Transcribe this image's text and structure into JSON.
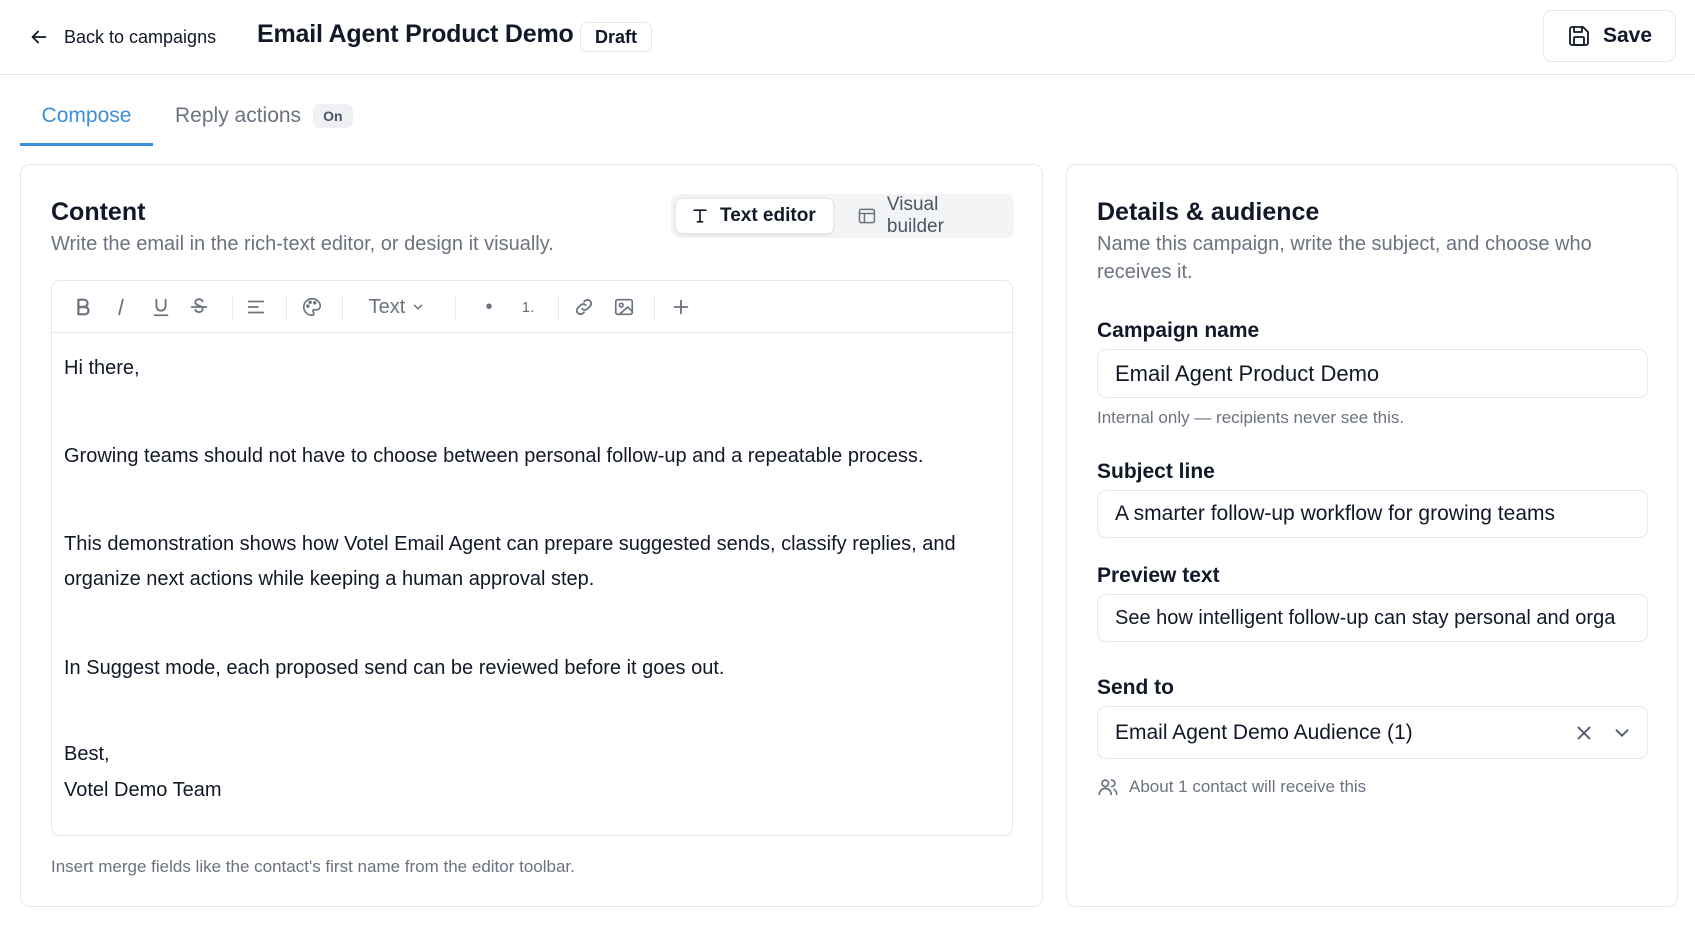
{
  "header": {
    "back_label": "Back to campaigns",
    "title": "Email Agent Product Demo",
    "status_badge": "Draft",
    "save_label": "Save"
  },
  "tabs": [
    {
      "label": "Compose",
      "active": true
    },
    {
      "label": "Reply actions",
      "badge": "On",
      "active": false
    }
  ],
  "content": {
    "title": "Content",
    "subtitle": "Write the email in the rich-text editor, or design it visually.",
    "mode_toggle": {
      "text_editor_label": "Text editor",
      "visual_builder_label": "Visual builder",
      "selected": "Text editor"
    },
    "toolbar": {
      "buttons": [
        "bold-icon",
        "italic-icon",
        "underline-icon",
        "strikethrough-icon",
        "align-icon",
        "palette-icon"
      ],
      "text_style_label": "Text",
      "bullet_label": "•",
      "numbered_label": "1.",
      "extra_buttons": [
        "link-icon",
        "image-icon",
        "plus-icon"
      ]
    },
    "body": {
      "greeting": "Hi there,",
      "paragraph_1": "Growing teams should not have to choose between personal follow-up and a repeatable process.",
      "paragraph_2": "This demonstration shows how Votel Email Agent can prepare suggested sends, classify replies, and organize next actions while keeping a human approval step.",
      "paragraph_3": "In Suggest mode, each proposed send can be reviewed before it goes out.",
      "signoff": "Best,",
      "signature": "Votel Demo Team"
    },
    "footer_note": "Insert merge fields like the contact's first name from the editor toolbar."
  },
  "details": {
    "title": "Details & audience",
    "subtitle": "Name this campaign, write the subject, and choose who receives it.",
    "campaign_name": {
      "label": "Campaign name",
      "value": "Email Agent Product Demo",
      "hint": "Internal only — recipients never see this."
    },
    "subject_line": {
      "label": "Subject line",
      "value": "A smarter follow-up workflow for growing teams"
    },
    "preview_text": {
      "label": "Preview text",
      "value": "See how intelligent follow-up can stay personal and orga"
    },
    "send_to": {
      "label": "Send to",
      "value": "Email Agent Demo Audience (1)",
      "hint": "About 1 contact will receive this"
    }
  },
  "colors": {
    "accent": "#3b8fd9",
    "border": "#e5e7eb",
    "muted_text": "#6b7280",
    "text": "#111827"
  }
}
